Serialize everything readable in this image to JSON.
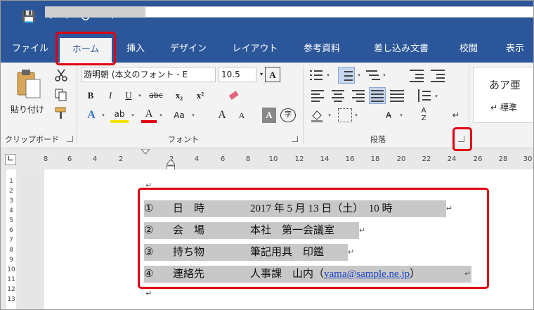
{
  "qat": {
    "save_icon": "💾",
    "undo_icon": "↶",
    "undo_dropdown": "▾",
    "redo_icon": "↺",
    "customize": "▾"
  },
  "tabs": [
    "ファイル",
    "ホーム",
    "挿入",
    "デザイン",
    "レイアウト",
    "参考資料",
    "差し込み文書",
    "校閲",
    "表示"
  ],
  "ribbon": {
    "clipboard": {
      "paste_label": "貼り付け",
      "group_label": "クリップボード"
    },
    "font": {
      "font_name": "游明朝 (本文のフォント - E",
      "font_size": "10.5",
      "bold": "B",
      "italic": "I",
      "underline": "U",
      "strike": "abc",
      "subscript": "x₂",
      "superscript": "x²",
      "text_effects": "A",
      "highlight": "ab",
      "font_color": "A",
      "change_case": "Aa",
      "grow": "A",
      "shrink": "A",
      "char_shading": "A",
      "enclose": "字",
      "font_a": "A",
      "group_label": "フォント"
    },
    "paragraph": {
      "group_label": "段落"
    },
    "styles": {
      "preview": "あア亜",
      "name": "↵ 標準"
    }
  },
  "ruler": {
    "ticks": [
      "8",
      "6",
      "4",
      "2",
      "2",
      "4",
      "6",
      "8",
      "10",
      "12",
      "14",
      "16",
      "18",
      "20",
      "22",
      "24",
      "26",
      "28",
      "30"
    ]
  },
  "vruler": {
    "ticks": [
      "1",
      "2",
      "3",
      "4",
      "5",
      "6",
      "7",
      "8",
      "9",
      "10",
      "11",
      "12",
      "13"
    ]
  },
  "document": {
    "rows": [
      {
        "num": "①",
        "label": "日　時",
        "value": "2017 年 5 月 13 日（土）　10 時"
      },
      {
        "num": "②",
        "label": "会　場",
        "value": "本社　第一会議室"
      },
      {
        "num": "③",
        "label": "持ち物",
        "value": "筆記用具　印鑑"
      },
      {
        "num": "④",
        "label": "連絡先",
        "value_pre": "人事課　山内（",
        "link": "yama@sample.ne.jp",
        "value_post": "）"
      }
    ]
  },
  "colors": {
    "brand": "#2b579a",
    "highlight_box": "#e00012",
    "selection": "#c8c8c8",
    "link": "#1a44c4"
  }
}
